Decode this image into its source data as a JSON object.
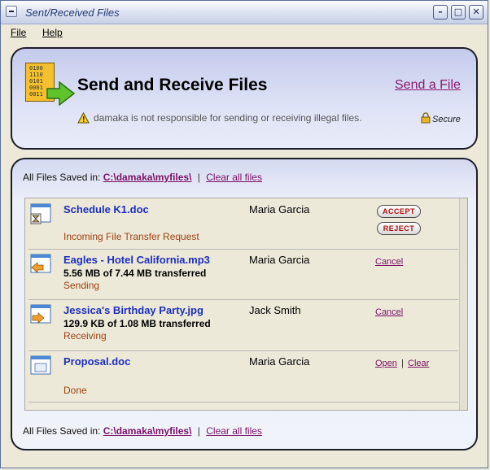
{
  "window": {
    "title": "Sent/Received Files"
  },
  "menu": [
    {
      "label": "File"
    },
    {
      "label": "Help"
    }
  ],
  "header": {
    "title": "Send and Receive Files",
    "send_link": "Send a File",
    "disclaimer": "damaka is not responsible for sending or receiving illegal files.",
    "secure": "Secure",
    "logo_bits": [
      "0100",
      "1110",
      "0101",
      "0001",
      "0011"
    ]
  },
  "saved": {
    "prefix": "All Files Saved in:",
    "path": "C:\\damaka\\myfiles\\",
    "separator": "|",
    "clear": "Clear all files"
  },
  "transfers": [
    {
      "name": "Schedule K1.doc",
      "sender": "Maria Garcia",
      "progress": "",
      "status": "Incoming File Transfer Request",
      "icon": "hourglass-file-icon",
      "actions": [
        "ACCEPT",
        "REJECT"
      ]
    },
    {
      "name": "Eagles - Hotel California.mp3",
      "sender": "Maria Garcia",
      "progress": "5.56 MB of 7.44 MB transferred",
      "status": "Sending",
      "icon": "send-file-icon",
      "actions": [
        "Cancel"
      ]
    },
    {
      "name": "Jessica's Birthday Party.jpg",
      "sender": "Jack Smith",
      "progress": "129.9 KB of 1.08 MB transferred",
      "status": "Receiving",
      "icon": "receive-file-icon",
      "actions": [
        "Cancel"
      ]
    },
    {
      "name": "Proposal.doc",
      "sender": "Maria Garcia",
      "progress": "",
      "status": "Done",
      "icon": "file-icon",
      "actions": [
        "Open",
        "|",
        "Clear"
      ]
    }
  ],
  "colors": {
    "link": "#7a1065",
    "file_name": "#1c2fbf",
    "status": "#a04010",
    "panel": "#dfe3f6"
  }
}
